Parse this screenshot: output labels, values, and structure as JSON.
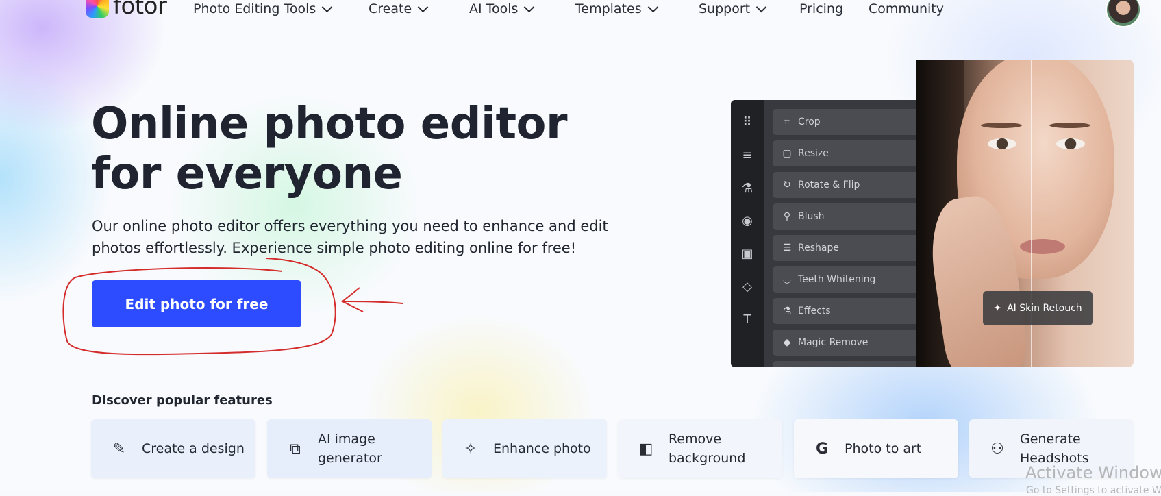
{
  "nav": {
    "logo_text": "fotor",
    "items": [
      {
        "label": "Photo Editing Tools",
        "dropdown": true
      },
      {
        "label": "Create",
        "dropdown": true
      },
      {
        "label": "AI Tools",
        "dropdown": true
      },
      {
        "label": "Templates",
        "dropdown": true
      },
      {
        "label": "Support",
        "dropdown": true
      },
      {
        "label": "Pricing",
        "dropdown": false
      },
      {
        "label": "Community",
        "dropdown": false
      }
    ]
  },
  "hero": {
    "title": "Online photo editor for everyone",
    "subtitle": "Our online photo editor offers everything you need to enhance and edit photos effortlessly. Experience simple photo editing online for free!",
    "cta_label": "Edit photo for free"
  },
  "editor": {
    "rail_icons": [
      "grid-icon",
      "sliders-icon",
      "flask-icon",
      "eye-icon",
      "frame-icon",
      "shapes-icon",
      "text-icon"
    ],
    "tools": [
      {
        "label": "Crop",
        "icon": "crop-icon"
      },
      {
        "label": "Resize",
        "icon": "resize-icon"
      },
      {
        "label": "Rotate & Flip",
        "icon": "rotate-icon"
      },
      {
        "label": "Blush",
        "icon": "blush-icon"
      },
      {
        "label": "Reshape",
        "icon": "reshape-icon"
      },
      {
        "label": "Teeth Whitening",
        "icon": "tooth-icon"
      },
      {
        "label": "Effects",
        "icon": "flask-icon"
      },
      {
        "label": "Magic Remove",
        "icon": "eraser-icon"
      }
    ],
    "photo_badge": "AI Skin Retouch"
  },
  "features": {
    "title": "Discover popular features",
    "cards": [
      {
        "label": "Create a design",
        "icon": "design-tools-icon",
        "bg": "#e9f0fb"
      },
      {
        "label": "AI image generator",
        "icon": "ai-image-icon",
        "bg": "#e6eefb"
      },
      {
        "label": "Enhance photo",
        "icon": "sparkle-icon",
        "bg": "#ecf2fb"
      },
      {
        "label": "Remove background",
        "icon": "remove-bg-icon",
        "bg": "#f2f5fb"
      },
      {
        "label": "Photo to art",
        "icon": "art-logo-icon",
        "bg": "#f6f8fc"
      },
      {
        "label": "Generate Headshots",
        "icon": "add-person-icon",
        "bg": "#f1f5fb"
      }
    ]
  },
  "os_watermark": {
    "line1": "Activate Windows",
    "line2": "Go to Settings to activate Windows."
  },
  "colors": {
    "cta": "#2d4bff",
    "annotation": "#d42b2b",
    "editor_panel": "#37393f"
  }
}
